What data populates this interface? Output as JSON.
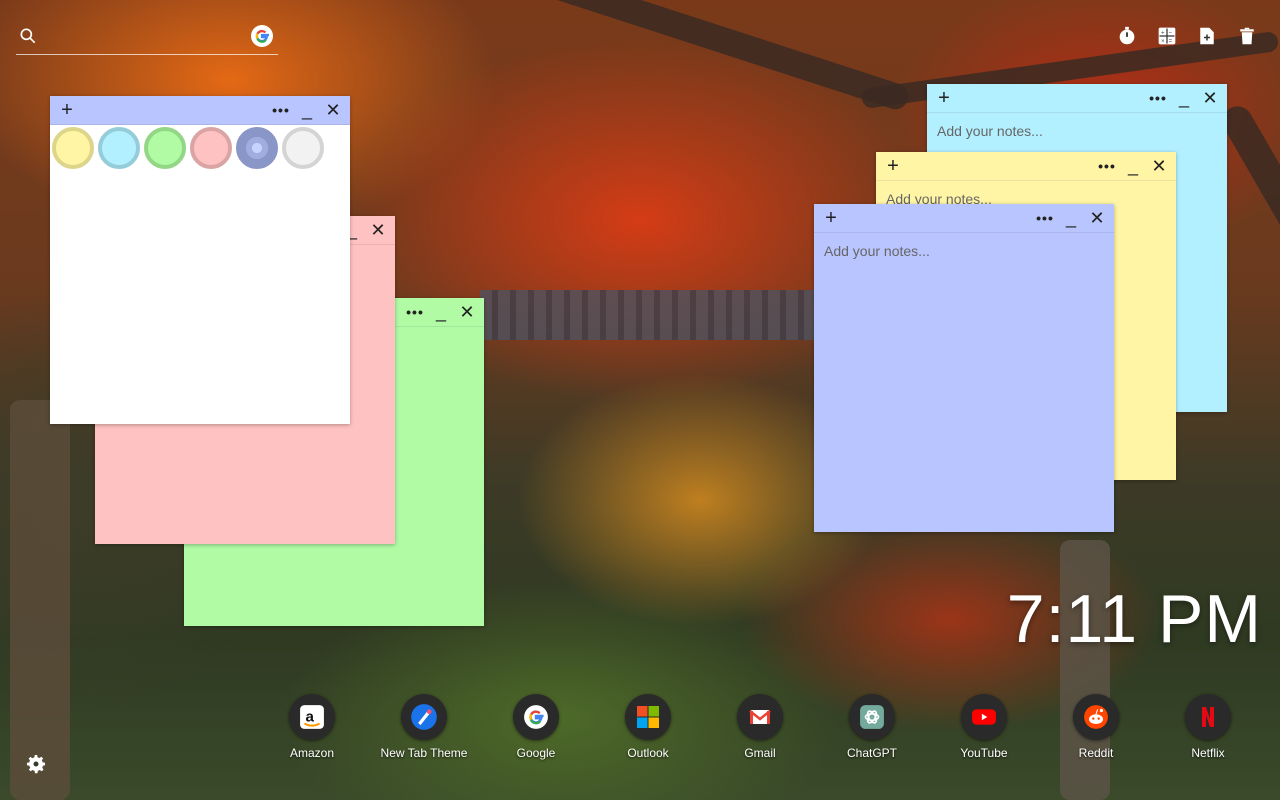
{
  "search": {
    "placeholder": ""
  },
  "notes": {
    "placeholder": "Add your notes...",
    "colors": {
      "yellow": "#fff5a5",
      "cyan": "#b3f0ff",
      "green": "#b1fba5",
      "pink": "#ffc2c2",
      "blue": "#b8c5ff",
      "white": "#ffffff"
    },
    "bar_icons": {
      "add": "+",
      "more": "•••",
      "minimize": "_",
      "close": "✕"
    }
  },
  "clock": {
    "time": "7:11 PM"
  },
  "shortcuts": [
    {
      "label": "Amazon",
      "icon": "amazon-icon"
    },
    {
      "label": "New Tab Theme",
      "icon": "new-tab-theme-icon"
    },
    {
      "label": "Google",
      "icon": "google-icon"
    },
    {
      "label": "Outlook",
      "icon": "outlook-icon"
    },
    {
      "label": "Gmail",
      "icon": "gmail-icon"
    },
    {
      "label": "ChatGPT",
      "icon": "chatgpt-icon"
    },
    {
      "label": "YouTube",
      "icon": "youtube-icon"
    },
    {
      "label": "Reddit",
      "icon": "reddit-icon"
    },
    {
      "label": "Netflix",
      "icon": "netflix-icon"
    }
  ]
}
